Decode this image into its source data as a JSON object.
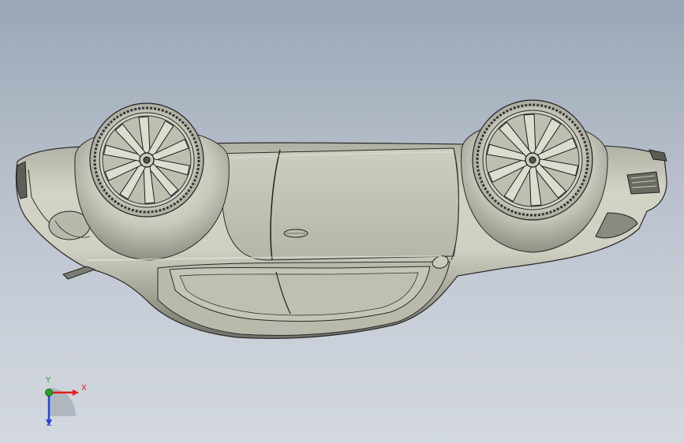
{
  "viewport": {
    "background_top": "#9ba6b6",
    "background_bottom": "#d3d8df"
  },
  "model": {
    "name": "car",
    "view": "upside-down",
    "body_color": "#c8c9bb",
    "edge_color": "#2a2a2a"
  },
  "triad": {
    "x_label": "X",
    "y_label": "Y",
    "z_label": "Z",
    "x_color": "#e0201c",
    "y_color": "#22a02a",
    "z_color": "#2046d8"
  }
}
